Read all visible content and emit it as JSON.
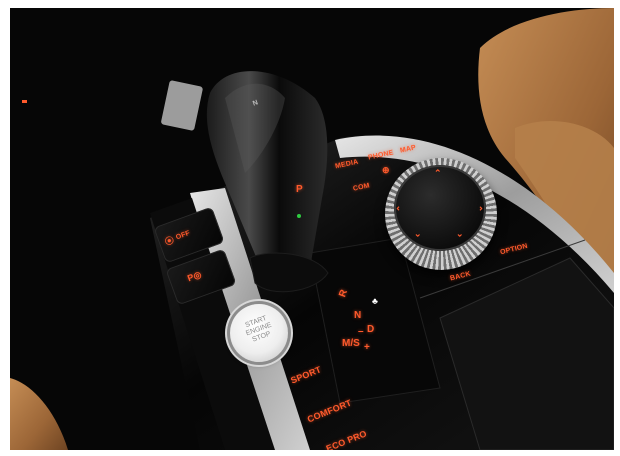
{
  "console": {
    "top_buttons": [
      "MEDIA",
      "PHONE",
      "MAP"
    ],
    "com_label": "COM",
    "nav_label": "⊕",
    "back_label": "BACK",
    "option_label": "OPTION",
    "dsc_label": "OFF",
    "start_label": "START\nENGINE\nSTOP",
    "modes": [
      "SPORT",
      "COMFORT",
      "ECO PRO"
    ]
  },
  "gear_display": {
    "r": "R",
    "n": "N",
    "d": "D",
    "ms": "M/S",
    "minus": "–",
    "plus": "+"
  },
  "shifter": {
    "p_label": "P",
    "top_mark": "N"
  },
  "colors": {
    "backlight": "#ff5a2c",
    "trim": "#b9b9b9",
    "leather": "#a8733f"
  }
}
